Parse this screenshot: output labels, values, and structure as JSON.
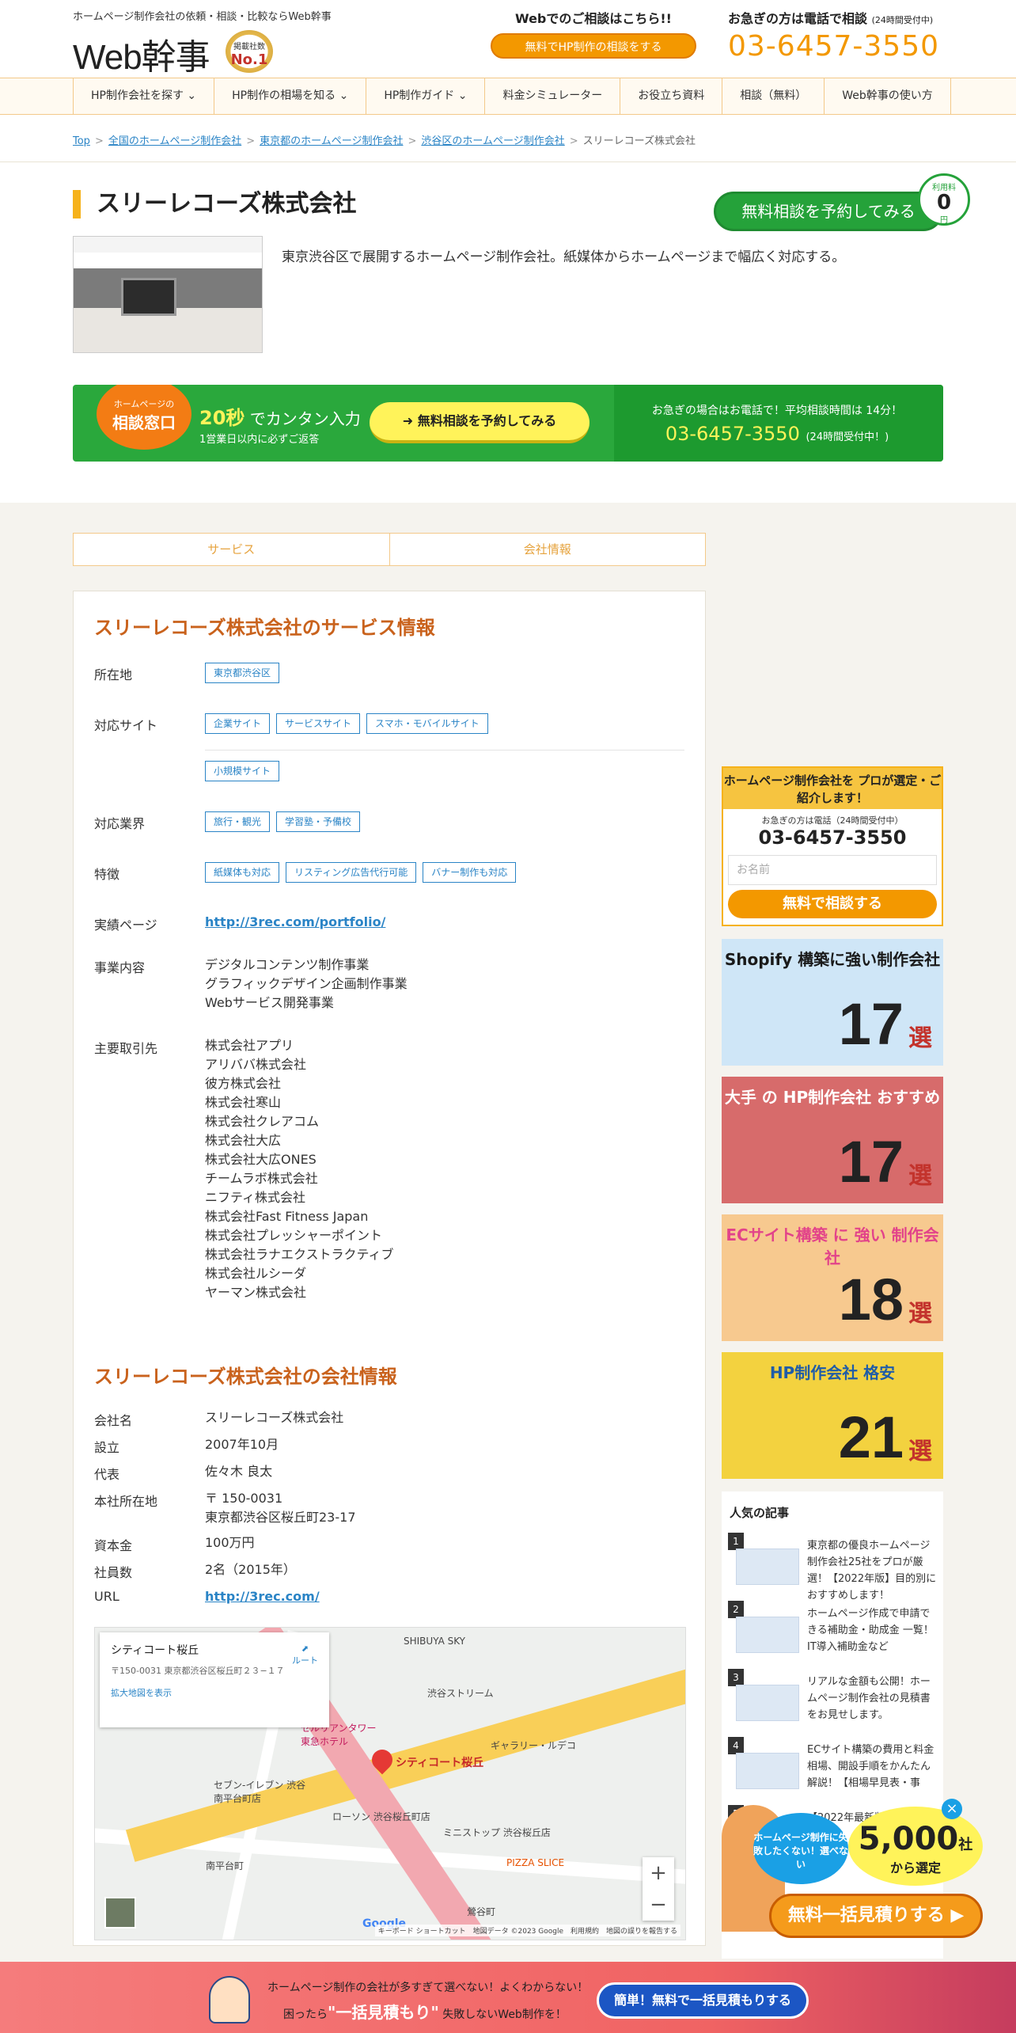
{
  "header": {
    "tagline": "ホームページ制作会社の依頼・相談・比較ならWeb幹事",
    "logo": "Web幹事",
    "badge_small": "掲載社数",
    "badge_big": "No.1",
    "web_title": "Webでのご相談はこちら!!",
    "web_button": "無料でHP制作の相談をする",
    "tel_title": "お急ぎの方は電話で相談",
    "tel_note": "(24時間受付中)",
    "tel_number": "03-6457-3550"
  },
  "nav": [
    "HP制作会社を探す ⌄",
    "HP制作の相場を知る ⌄",
    "HP制作ガイド ⌄",
    "料金シミュレーター",
    "お役立ち資料",
    "相談（無料）",
    "Web幹事の使い方"
  ],
  "breadcrumb": [
    "Top",
    "全国のホームページ制作会社",
    "東京都のホームページ制作会社",
    "渋谷区のホームページ制作会社",
    "スリーレコーズ株式会社"
  ],
  "company": {
    "name": "スリーレコーズ株式会社",
    "description": "東京渋谷区で展開するホームページ制作会社。紙媒体からホームページまで幅広く対応する。",
    "reserve_button": "無料相談を予約してみる",
    "fee_small": "利用料",
    "fee_value": "0",
    "fee_unit": "円"
  },
  "banner": {
    "bubble_small": "ホームページの",
    "bubble_big": "相談窓口",
    "seconds": "20秒",
    "main_text": "でカンタン入力",
    "sub_text": "1営業日以内に必ずご返答",
    "button": "無料相談を予約してみる",
    "right_line1": "お急ぎの場合はお電話で！平均相談時間は 14分！",
    "right_number": "03-6457-3550",
    "right_note": "(24時間受付中！)"
  },
  "tabs": [
    "サービス",
    "会社情報"
  ],
  "services": {
    "title": "スリーレコーズ株式会社のサービス情報",
    "location_label": "所在地",
    "location_tags": [
      "東京都渋谷区"
    ],
    "site_label": "対応サイト",
    "site_tags_row1": [
      "企業サイト",
      "サービスサイト",
      "スマホ・モバイルサイト"
    ],
    "site_tags_row2": [
      "小規模サイト"
    ],
    "industry_label": "対応業界",
    "industry_tags": [
      "旅行・観光",
      "学習塾・予備校"
    ],
    "feature_label": "特徴",
    "feature_tags": [
      "紙媒体も対応",
      "リスティング広告代行可能",
      "バナー制作も対応"
    ],
    "works_label": "実績ページ",
    "works_url": "http://3rec.com/portfolio/",
    "business_label": "事業内容",
    "business": [
      "デジタルコンテンツ制作事業",
      "グラフィックデザイン企画制作事業",
      "Webサービス開発事業"
    ],
    "clients_label": "主要取引先",
    "clients": [
      "株式会社アプリ",
      "アリババ株式会社",
      "彼方株式会社",
      "株式会社寒山",
      "株式会社クレアコム",
      "株式会社大広",
      "株式会社大広ONES",
      "チームラボ株式会社",
      "ニフティ株式会社",
      "株式会社Fast Fitness Japan",
      "株式会社プレッシャーポイント",
      "株式会社ラナエクストラクティブ",
      "株式会社ルシーダ",
      "ヤーマン株式会社"
    ]
  },
  "info": {
    "title": "スリーレコーズ株式会社の会社情報",
    "rows": [
      {
        "label": "会社名",
        "value": "スリーレコーズ株式会社"
      },
      {
        "label": "設立",
        "value": "2007年10月"
      },
      {
        "label": "代表",
        "value": "佐々木 良太"
      },
      {
        "label": "本社所在地",
        "value": "〒 150-0031",
        "value2": "東京都渋谷区桜丘町23-17"
      },
      {
        "label": "資本金",
        "value": "100万円"
      },
      {
        "label": "社員数",
        "value": "2名（2015年）"
      },
      {
        "label": "URL",
        "value": "http://3rec.com/"
      }
    ]
  },
  "map": {
    "place": "シティコート桜丘",
    "address": "〒150-0031 東京都渋谷区桜丘町２３−１７",
    "route": "ルート",
    "enlarge": "拡大地図を表示",
    "pin_label": "シティコート桜丘",
    "labels": [
      "SHIBUYA SKY",
      "渋谷ストリーム",
      "セルリアンタワー 東急ホテル",
      "ローソン 渋谷桜丘町店",
      "ミニストップ 渋谷桜丘店",
      "南平台町",
      "鶯谷町",
      "PIZZA SLICE",
      "ギャラリー・ルデコ",
      "セブン-イレブン 渋谷南平台町店"
    ],
    "footer": "キーボード ショートカット　地図データ ©2023 Google　利用規約　地図の誤りを報告する",
    "google": "Google"
  },
  "sidebar": {
    "box_title": "ホームページ制作会社を プロが選定・ご紹介します！",
    "box_sub": "お急ぎの方は電話（24時間受付中）",
    "box_number": "03-6457-3550",
    "box_placeholder": "お名前",
    "box_button": "無料で相談する",
    "ads": [
      {
        "title": "Shopify 構築に強い制作会社",
        "num": "17",
        "sen": "選",
        "bg": "#cfe6f7"
      },
      {
        "title": "大手 の HP制作会社 おすすめ",
        "num": "17",
        "sen": "選",
        "bg": "#d76b6b"
      },
      {
        "title": "ECサイト構築 に 強い 制作会社",
        "num": "18",
        "sen": "選",
        "bg": "#f7c98f"
      },
      {
        "title": "HP制作会社 格安",
        "num": "21",
        "sen": "選",
        "bg": "#f3d23f"
      }
    ],
    "popular_title": "人気の記事",
    "popular": [
      {
        "no": "1",
        "text": "東京都の優良ホームページ制作会社25社をプロが厳選！【2022年版】目的別におすすめします！"
      },
      {
        "no": "2",
        "text": "ホームページ作成で申請できる補助金・助成金 一覧！IT導入補助金など"
      },
      {
        "no": "3",
        "text": "リアルな金額も公開！ホームページ制作会社の見積書をお見せします。"
      },
      {
        "no": "4",
        "text": "ECサイト構築の費用と料金相場、開設手順をかんたん解説！【相場早見表・事"
      },
      {
        "no": "5",
        "text": "【2022年最新版"
      }
    ]
  },
  "floating": {
    "bubble": "ホームページ制作に失敗したくない！選べない",
    "count": "5,000",
    "count_sub": "から選定",
    "count_unit": "社",
    "button": "無料一括見積りする ▶"
  },
  "footer_bar": {
    "line1": "ホームページ制作の会社が多すぎて選べない！よくわからない！",
    "line2a": "困ったら",
    "line2b": "\"一括見積もり\"",
    "line2c": "失敗しないWeb制作を！",
    "button": "簡単！無料で一括見積もりする"
  }
}
